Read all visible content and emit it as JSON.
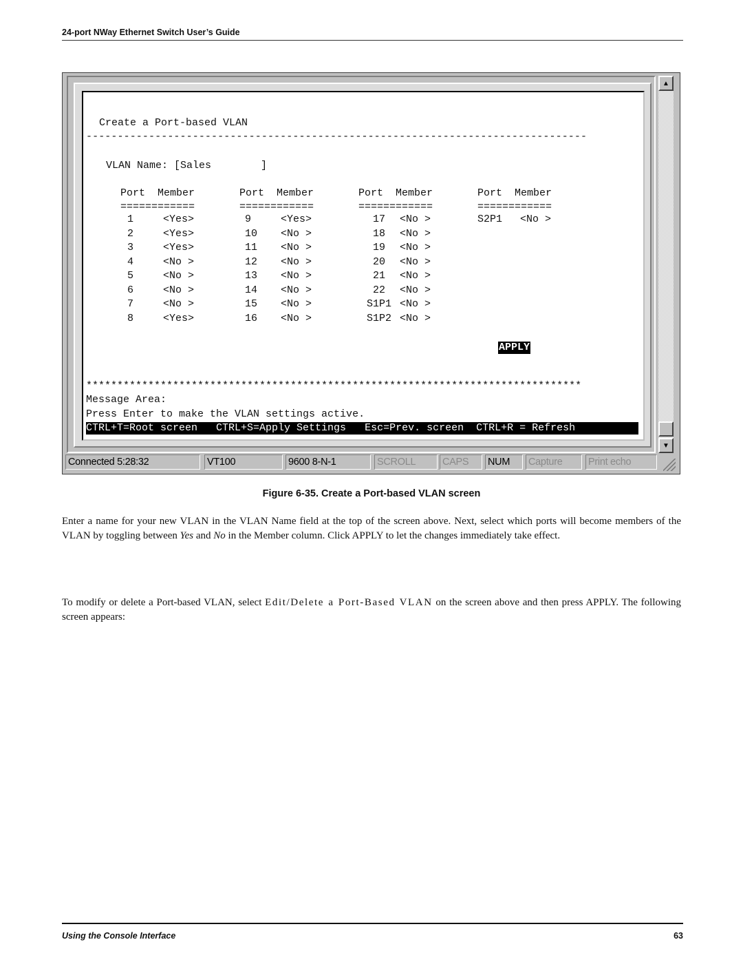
{
  "page_header": "24-port NWay Ethernet Switch User’s Guide",
  "terminal": {
    "title": "Create a Port-based VLAN",
    "dash_line": "--------------------------------------------------------------------------------",
    "vlan_name_label": "VLAN Name:",
    "vlan_name_value": "[Sales        ]",
    "column_header": "Port  Member",
    "column_rule": "============",
    "columns": [
      [
        {
          "port": "1",
          "member": "<Yes>"
        },
        {
          "port": "2",
          "member": "<Yes>"
        },
        {
          "port": "3",
          "member": "<Yes>"
        },
        {
          "port": "4",
          "member": "<No >"
        },
        {
          "port": "5",
          "member": "<No >"
        },
        {
          "port": "6",
          "member": "<No >"
        },
        {
          "port": "7",
          "member": "<No >"
        },
        {
          "port": "8",
          "member": "<Yes>"
        }
      ],
      [
        {
          "port": "9",
          "member": "<Yes>"
        },
        {
          "port": "10",
          "member": "<No >"
        },
        {
          "port": "11",
          "member": "<No >"
        },
        {
          "port": "12",
          "member": "<No >"
        },
        {
          "port": "13",
          "member": "<No >"
        },
        {
          "port": "14",
          "member": "<No >"
        },
        {
          "port": "15",
          "member": "<No >"
        },
        {
          "port": "16",
          "member": "<No >"
        }
      ],
      [
        {
          "port": "17",
          "member": "<No >"
        },
        {
          "port": "18",
          "member": "<No >"
        },
        {
          "port": "19",
          "member": "<No >"
        },
        {
          "port": "20",
          "member": "<No >"
        },
        {
          "port": "21",
          "member": "<No >"
        },
        {
          "port": "22",
          "member": "<No >"
        },
        {
          "port": "S1P1",
          "member": "<No >"
        },
        {
          "port": "S1P2",
          "member": "<No >"
        }
      ],
      [
        {
          "port": "S2P1",
          "member": "<No >"
        }
      ]
    ],
    "apply_label": "APPLY",
    "star_line": "********************************************************************************",
    "message_area_label": "Message Area:",
    "message_text": "Press Enter to make the VLAN settings active.",
    "key_help": "CTRL+T=Root screen   CTRL+S=Apply Settings   Esc=Prev. screen  CTRL+R = Refresh"
  },
  "status_bar": {
    "connected": "Connected 5:28:32",
    "emulation": "VT100",
    "port_settings": "9600 8-N-1",
    "scroll": "SCROLL",
    "caps": "CAPS",
    "num": "NUM",
    "capture": "Capture",
    "print_echo": "Print echo"
  },
  "figure_caption": "Figure 6-35.  Create a Port-based VLAN screen",
  "paragraph1": {
    "part1": "Enter a name for your new VLAN in the VLAN Name field at the top of the screen above. Next, select which ports will become members of the VLAN by toggling between ",
    "yes": "Yes",
    "part2": " and ",
    "no": "No",
    "part3": " in the Member column. Click APPLY to let the changes immediately take effect."
  },
  "paragraph2": {
    "part1": "To modify or delete a Port-based VLAN, select ",
    "menu_item": "Edit/Delete a Port-Based VLAN",
    "part2": " on the screen above and then press APPLY. The following screen appears:"
  },
  "footer": {
    "section": "Using the Console Interface",
    "page_number": "63"
  }
}
